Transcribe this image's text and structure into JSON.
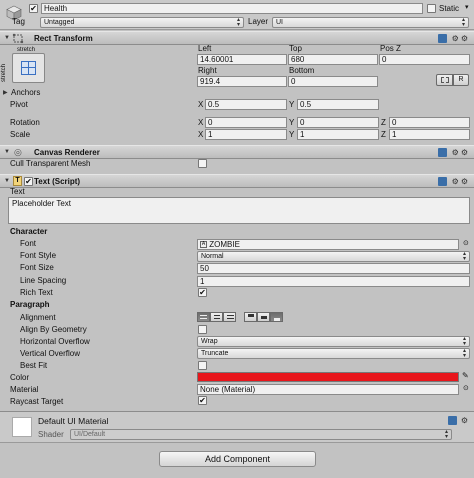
{
  "header": {
    "object_name": "Health",
    "static_label": "Static",
    "tag_label": "Tag",
    "tag_value": "Untagged",
    "layer_label": "Layer",
    "layer_value": "UI"
  },
  "rect_transform": {
    "title": "Rect Transform",
    "anchor_preset_label": "stretch",
    "anchor_preset_side_label": "stretch",
    "col_left": "Left",
    "col_top": "Top",
    "col_posz": "Pos Z",
    "col_right": "Right",
    "col_bottom": "Bottom",
    "left": "14.60001",
    "top": "680",
    "posz": "0",
    "right": "919.4",
    "bottom": "0",
    "r_button": "R",
    "anchors_label": "Anchors",
    "pivot_label": "Pivot",
    "pivot_x": "0.5",
    "pivot_y": "0.5",
    "rotation_label": "Rotation",
    "rotation_x": "0",
    "rotation_y": "0",
    "rotation_z": "0",
    "scale_label": "Scale",
    "scale_x": "1",
    "scale_y": "1",
    "scale_z": "1",
    "x": "X",
    "y": "Y",
    "z": "Z"
  },
  "canvas_renderer": {
    "title": "Canvas Renderer",
    "cull_label": "Cull Transparent Mesh"
  },
  "text_script": {
    "title": "Text (Script)",
    "text_label": "Text",
    "text_value": "Placeholder Text",
    "character_label": "Character",
    "font_label": "Font",
    "font_value": "ZOMBIE",
    "font_style_label": "Font Style",
    "font_style_value": "Normal",
    "font_size_label": "Font Size",
    "font_size_value": "50",
    "line_spacing_label": "Line Spacing",
    "line_spacing_value": "1",
    "rich_text_label": "Rich Text",
    "paragraph_label": "Paragraph",
    "alignment_label": "Alignment",
    "align_geometry_label": "Align By Geometry",
    "h_overflow_label": "Horizontal Overflow",
    "h_overflow_value": "Wrap",
    "v_overflow_label": "Vertical Overflow",
    "v_overflow_value": "Truncate",
    "best_fit_label": "Best Fit",
    "color_label": "Color",
    "color_value": "#e8151b",
    "material_label": "Material",
    "material_value": "None (Material)",
    "raycast_label": "Raycast Target"
  },
  "material": {
    "name": "Default UI Material",
    "shader_label": "Shader",
    "shader_value": "UI/Default"
  },
  "add_component_label": "Add Component",
  "icons": {
    "check": "✔",
    "gear": "⚙",
    "link": "⊙",
    "eyedropper": "✎"
  }
}
